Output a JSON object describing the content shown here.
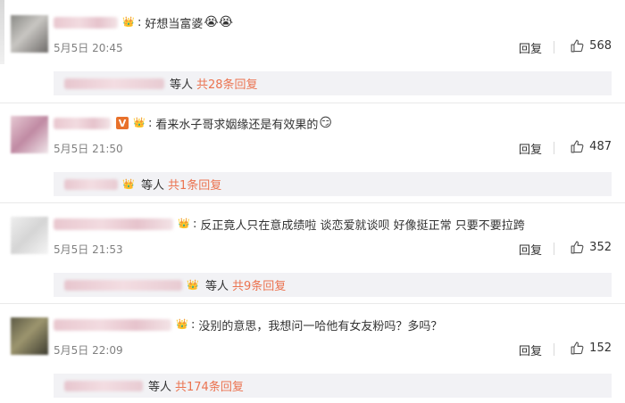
{
  "comments": [
    {
      "text": "好想当富婆",
      "emoji": "😭😭",
      "time": "5月5日 20:45",
      "reply_label": "回复",
      "likes": "568",
      "replies_prefix": "等人",
      "replies_link": "共28条回复"
    },
    {
      "vbadge": "V",
      "text": "看来水子哥求姻缘还是有效果的",
      "emoji": "😏",
      "time": "5月5日 21:50",
      "reply_label": "回复",
      "likes": "487",
      "replies_prefix": "等人",
      "replies_link": "共1条回复"
    },
    {
      "text": "反正竟人只在意成绩啦 谈恋爱就谈呗 好像挺正常 只要不要拉跨",
      "time": "5月5日 21:53",
      "reply_label": "回复",
      "likes": "352",
      "replies_prefix": "等人",
      "replies_link": "共9条回复"
    },
    {
      "text": "没别的意思，我想问一哈他有女友粉吗？多吗？",
      "time": "5月5日 22:09",
      "reply_label": "回复",
      "likes": "152",
      "replies_prefix": "等人",
      "replies_link": "共174条回复"
    }
  ],
  "icons": {
    "like": "thumbs-up-icon",
    "vip": "crown-icon"
  },
  "colors": {
    "accent": "#eb7350",
    "reply_bg": "#f2f2f5",
    "muted": "#808080"
  }
}
